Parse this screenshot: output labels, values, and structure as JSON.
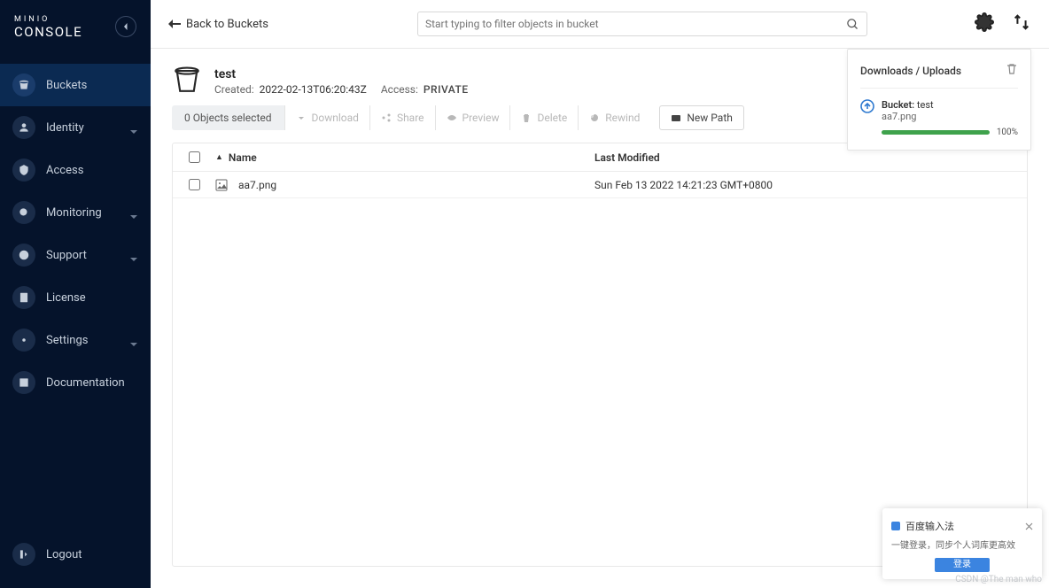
{
  "logo": {
    "top": "MINIO",
    "bottom": "CONSOLE"
  },
  "sidebar": {
    "items": [
      {
        "label": "Buckets",
        "active": true
      },
      {
        "label": "Identity",
        "chevron": true
      },
      {
        "label": "Access"
      },
      {
        "label": "Monitoring",
        "chevron": true
      },
      {
        "label": "Support",
        "chevron": true
      },
      {
        "label": "License"
      },
      {
        "label": "Settings",
        "chevron": true
      },
      {
        "label": "Documentation"
      }
    ],
    "logout": "Logout"
  },
  "topbar": {
    "back": "Back to Buckets",
    "search_placeholder": "Start typing to filter objects in bucket"
  },
  "bucket": {
    "name": "test",
    "created_label": "Created:",
    "created_value": "2022-02-13T06:20:43Z",
    "access_label": "Access:",
    "access_value": "PRIVATE"
  },
  "toolbar": {
    "selected": "0 Objects selected",
    "download": "Download",
    "share": "Share",
    "preview": "Preview",
    "delete": "Delete",
    "rewind": "Rewind",
    "newpath": "New Path"
  },
  "table": {
    "name_header": "Name",
    "modified_header": "Last Modified",
    "rows": [
      {
        "name": "aa7.png",
        "modified": "Sun Feb 13 2022 14:21:23 GMT+0800"
      }
    ]
  },
  "downloads": {
    "title": "Downloads / Uploads",
    "bucket_label": "Bucket:",
    "bucket_name": "test",
    "file": "aa7.png",
    "pct": "100%",
    "progress": 100
  },
  "toast": {
    "title": "百度输入法",
    "desc": "一键登录，同步个人词库更高效",
    "button": "登录"
  },
  "watermark": "CSDN @The man who"
}
